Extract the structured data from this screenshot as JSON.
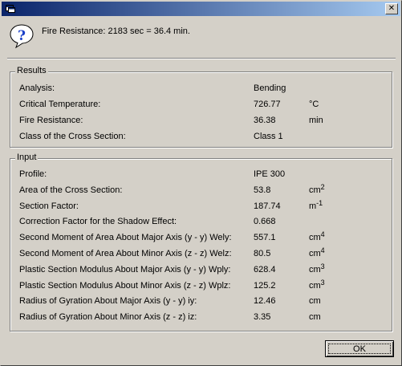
{
  "window": {
    "title": "",
    "close_symbol": "✕"
  },
  "message": "Fire Resistance: 2183 sec = 36.4 min.",
  "results": {
    "legend": "Results",
    "rows": [
      {
        "label": "Analysis:",
        "value": "Bending",
        "unit": "",
        "sup": ""
      },
      {
        "label": "Critical Temperature:",
        "value": "726.77",
        "unit": "°C",
        "sup": ""
      },
      {
        "label": "Fire Resistance:",
        "value": "36.38",
        "unit": "min",
        "sup": ""
      },
      {
        "label": "Class of the Cross Section:",
        "value": "Class 1",
        "unit": "",
        "sup": ""
      }
    ]
  },
  "input": {
    "legend": "Input",
    "rows": [
      {
        "label": "Profile:",
        "value": "IPE 300",
        "unit": "",
        "sup": ""
      },
      {
        "label": "Area of the Cross Section:",
        "value": "53.8",
        "unit": "cm",
        "sup": "2"
      },
      {
        "label": "Section Factor:",
        "value": "187.74",
        "unit": "m",
        "sup": "-1"
      },
      {
        "label": "Correction Factor for the Shadow Effect:",
        "value": "0.668",
        "unit": "",
        "sup": ""
      },
      {
        "label": "Second Moment of Area About Major Axis (y - y) Wely:",
        "value": "557.1",
        "unit": "cm",
        "sup": "4"
      },
      {
        "label": "Second Moment of Area About Minor Axis (z - z) Welz:",
        "value": "80.5",
        "unit": "cm",
        "sup": "4"
      },
      {
        "label": "Plastic Section Modulus About Major Axis (y - y) Wply:",
        "value": "628.4",
        "unit": "cm",
        "sup": "3"
      },
      {
        "label": "Plastic Section Modulus About Minor Axis (z - z) Wplz:",
        "value": "125.2",
        "unit": "cm",
        "sup": "3"
      },
      {
        "label": "Radius of Gyration About Major Axis (y - y) iy:",
        "value": "12.46",
        "unit": "cm",
        "sup": ""
      },
      {
        "label": "Radius of Gyration About Minor Axis (z - z) iz:",
        "value": "3.35",
        "unit": "cm",
        "sup": ""
      }
    ]
  },
  "buttons": {
    "ok_label": "OK"
  },
  "icons": {
    "app": "window-app-icon",
    "message": "question-icon"
  },
  "colors": {
    "titlebar_start": "#0a246a",
    "titlebar_end": "#a6caf0",
    "face": "#d4d0c8",
    "question_blue": "#1a3fc8"
  }
}
